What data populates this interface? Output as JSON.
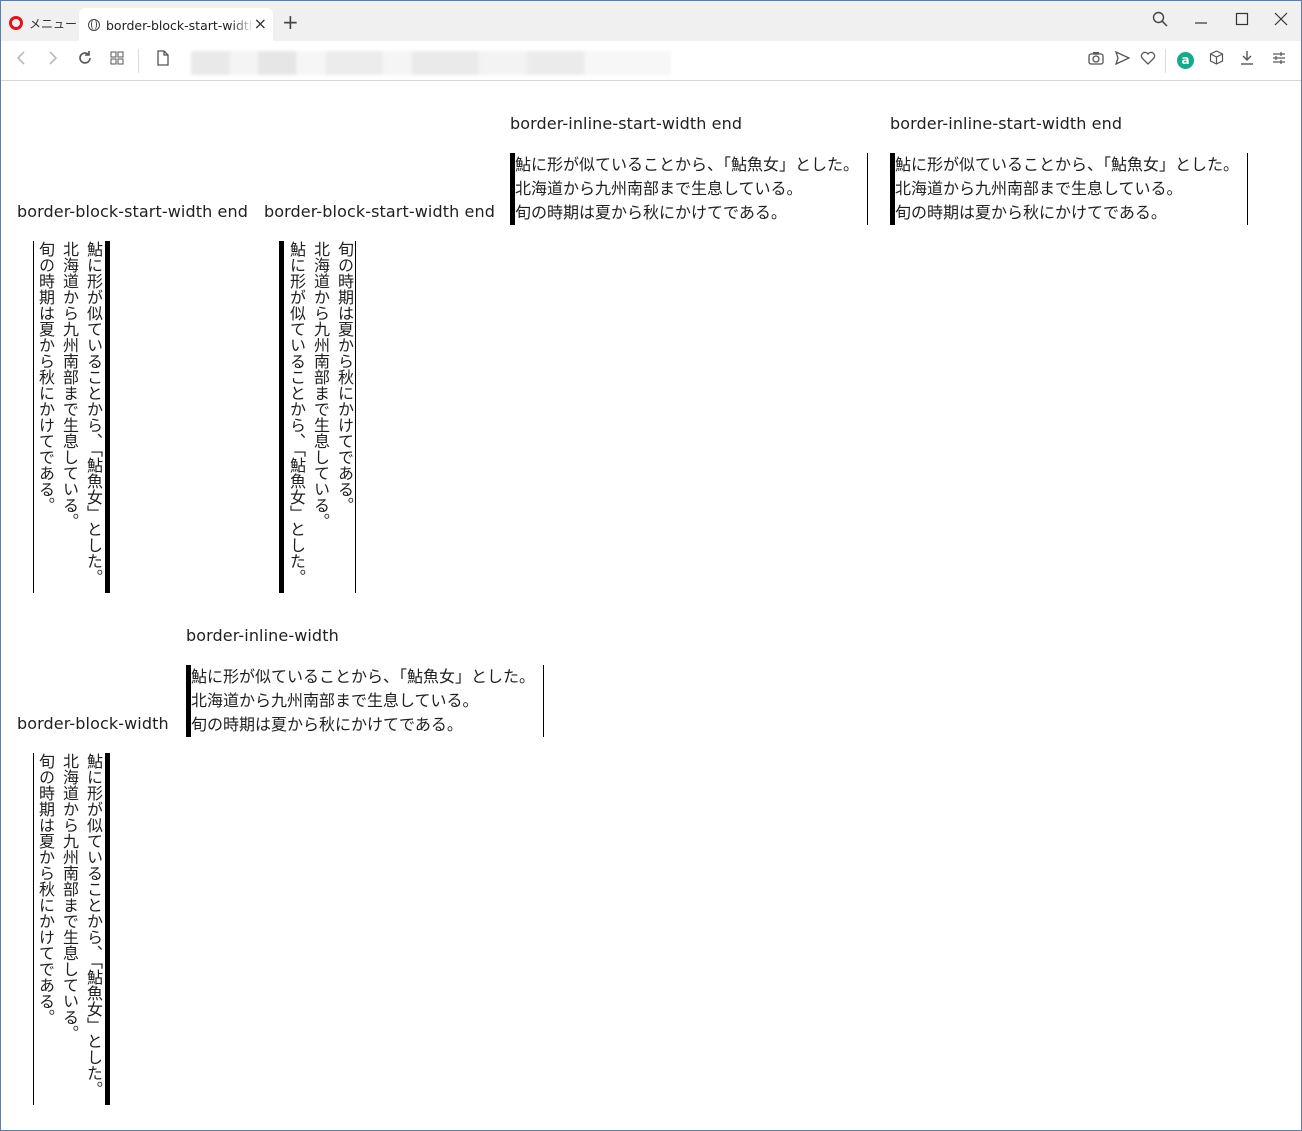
{
  "browser": {
    "menu_label": "メニュー",
    "tab_title": "border-block-start-widthプロパティ",
    "tab_close": "×",
    "new_tab": "+",
    "window_controls": {
      "search": "search-icon",
      "minimize": "—",
      "maximize": "☐",
      "close": "✕"
    }
  },
  "nav": {
    "back": "back-icon",
    "forward": "forward-icon",
    "reload": "reload-icon",
    "tabs_grid": "grid-icon",
    "page_icon": "page-icon",
    "right_icons": [
      "camera-icon",
      "send-icon",
      "heart-icon",
      "aria-icon",
      "cube-icon",
      "download-icon",
      "easy-setup-icon"
    ],
    "aria_letter": "a"
  },
  "page": {
    "sample_lines": [
      "鮎に形が似ていることから、「鮎魚女」とした。",
      "北海道から九州南部まで生息している。",
      "旬の時期は夏から秋にかけてである。"
    ],
    "sections": [
      {
        "label": "border-block-start-width end"
      },
      {
        "label": "border-block-start-width end"
      },
      {
        "label": "border-inline-start-width end"
      },
      {
        "label": "border-inline-start-width end"
      },
      {
        "label": "border-block-width"
      },
      {
        "label": "border-inline-width"
      }
    ]
  }
}
